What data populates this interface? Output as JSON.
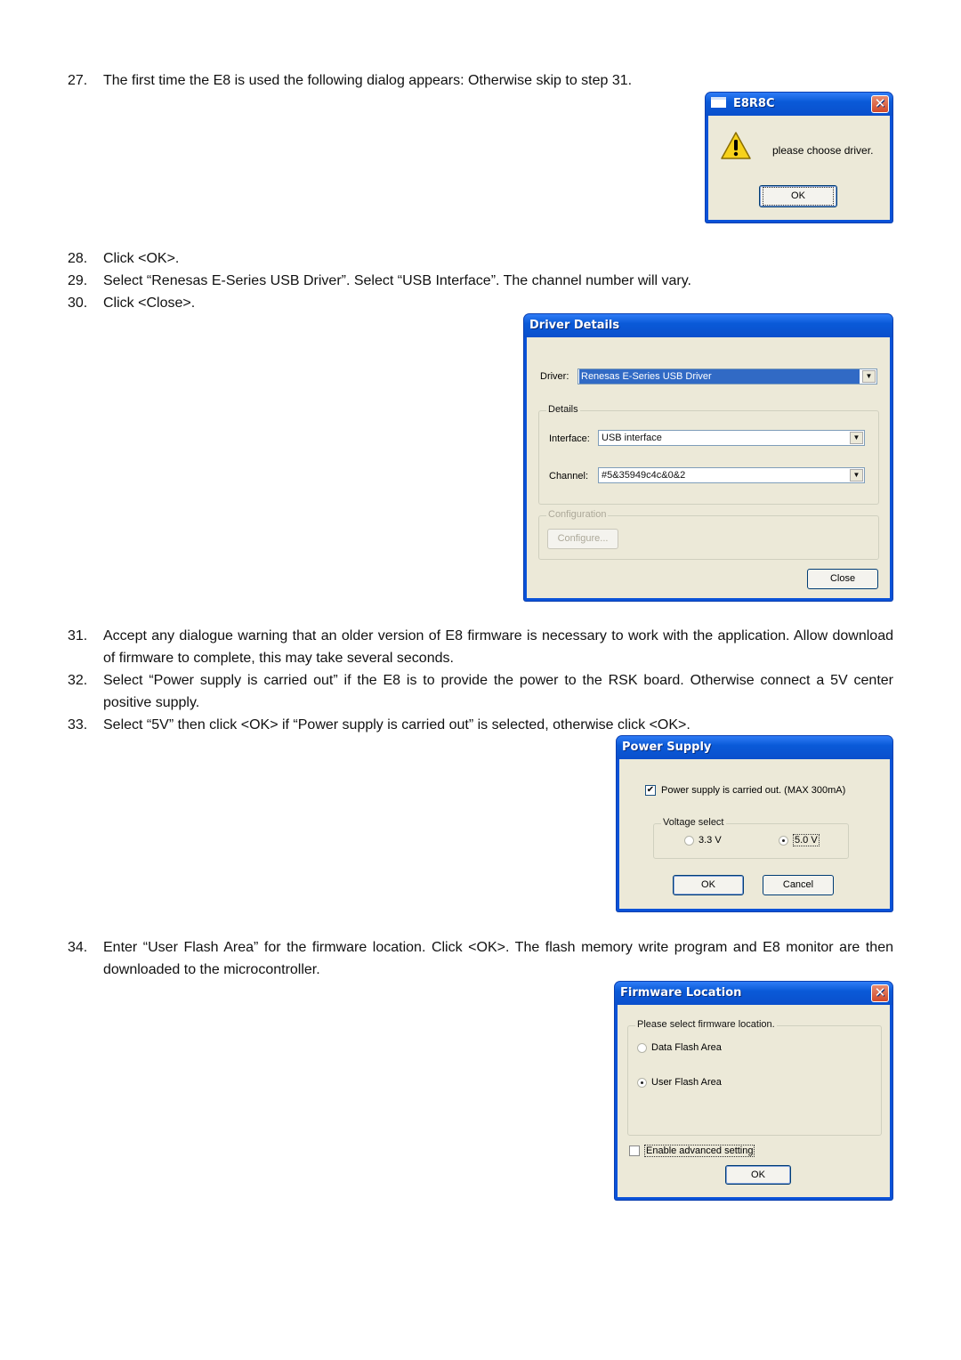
{
  "steps": [
    {
      "num": "27.",
      "text": "The first time the E8 is used the following dialog appears: Otherwise skip to step 31."
    },
    {
      "num": "28.",
      "text": "Click <OK>."
    },
    {
      "num": "29.",
      "text": "Select “Renesas E-Series USB Driver”. Select “USB Interface”. The channel number will vary."
    },
    {
      "num": "30.",
      "text": "Click <Close>."
    },
    {
      "num": "31.",
      "text": "Accept any dialogue warning that an older version of E8 firmware is necessary to work with the application. Allow download of firmware to complete, this may take several seconds."
    },
    {
      "num": "32.",
      "text": "Select “Power supply is carried out” if the E8 is to provide the power to the RSK board. Otherwise connect a 5V center positive supply."
    },
    {
      "num": "33.",
      "text": "Select “5V” then click <OK> if “Power supply is carried out” is selected, otherwise click <OK>."
    },
    {
      "num": "34.",
      "text": "Enter “User Flash Area” for the firmware location. Click <OK>. The flash memory write program and E8 monitor are then downloaded to the microcontroller."
    }
  ],
  "dialog_e8r8c": {
    "title": "E8R8C",
    "close_glyph": "✕",
    "icon": "warning-icon",
    "message": "please choose driver.",
    "ok_label": "OK"
  },
  "dialog_driver": {
    "title": "Driver Details",
    "driver_label": "Driver:",
    "driver_value": "Renesas E-Series USB Driver",
    "details_legend": "Details",
    "interface_label": "Interface:",
    "interface_value": "USB interface",
    "channel_label": "Channel:",
    "channel_value": "#5&35949c4c&0&2",
    "configuration_legend": "Configuration",
    "configure_label": "Configure...",
    "close_label": "Close",
    "dropdown_glyph": "▼"
  },
  "dialog_power": {
    "title": "Power Supply",
    "checkbox_label": "Power supply is carried out. (MAX 300mA)",
    "checkbox_checked": true,
    "voltage_legend": "Voltage select",
    "options": [
      "3.3 V",
      "5.0 V"
    ],
    "selected": "5.0 V",
    "ok_label": "OK",
    "cancel_label": "Cancel",
    "check_glyph": "✔"
  },
  "dialog_firmware": {
    "title": "Firmware Location",
    "close_glyph": "✕",
    "group_legend": "Please select firmware location.",
    "options": [
      "Data Flash Area",
      "User Flash Area"
    ],
    "selected": "User Flash Area",
    "advanced_label": "Enable advanced setting",
    "advanced_checked": false,
    "ok_label": "OK"
  }
}
